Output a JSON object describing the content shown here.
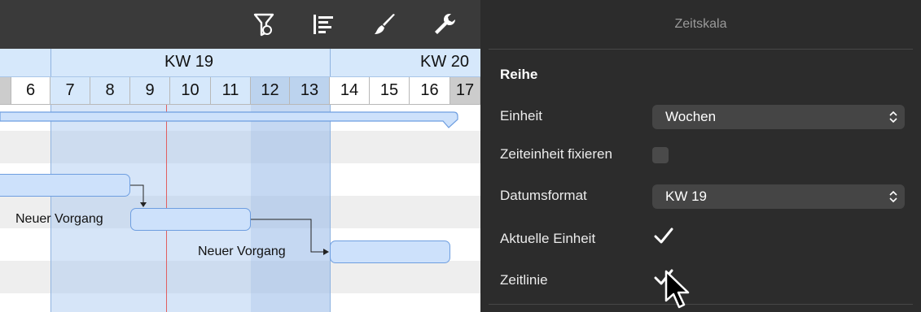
{
  "toolbar": {
    "icons": [
      "filter-icon",
      "gantt-layout-icon",
      "brush-icon",
      "wrench-icon"
    ]
  },
  "gantt": {
    "weeks": [
      "KW 19",
      "KW 20"
    ],
    "days": [
      "6",
      "7",
      "8",
      "9",
      "10",
      "11",
      "12",
      "13",
      "14",
      "15",
      "16",
      "17"
    ],
    "tasks": [
      {
        "label": ""
      },
      {
        "label": "Neuer Vorgang"
      },
      {
        "label": "Neuer Vorgang"
      }
    ],
    "colors": {
      "header_blue": "#d6e8fb",
      "today_line": "#e06060",
      "bar_fill": "#cde1fb",
      "bar_border": "#6e9ee0"
    }
  },
  "inspector": {
    "title": "Zeitskala",
    "section": "Reihe",
    "unit_label": "Einheit",
    "unit_value": "Wochen",
    "fix_label": "Zeiteinheit fixieren",
    "fix_checked": false,
    "date_format_label": "Datumsformat",
    "date_format_value": "KW 19",
    "current_unit_label": "Aktuelle Einheit",
    "current_unit_checked": true,
    "timeline_label": "Zeitlinie",
    "timeline_checked": true
  }
}
